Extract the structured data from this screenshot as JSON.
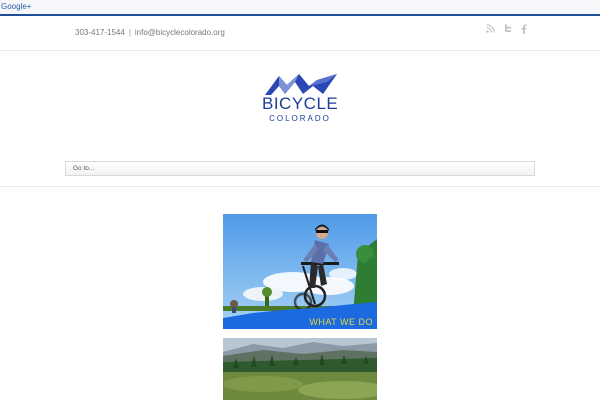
{
  "google_bar": {
    "link": "Google+"
  },
  "topbar": {
    "phone": "303-417-1544",
    "separator": "|",
    "email": "info@bicyclecolorado.org",
    "social_icons": [
      "rss-icon",
      "twitter-icon",
      "facebook-icon"
    ]
  },
  "logo": {
    "line1": "BICYCLE",
    "line2": "COLORADO",
    "color": "#1c3f9a"
  },
  "nav": {
    "select_label": "Go to..."
  },
  "tiles": [
    {
      "caption": "WHAT WE DO",
      "band_color": "#1f6fe0"
    },
    {
      "caption": ""
    }
  ],
  "colors": {
    "brand_blue": "#1c3f9a",
    "google_bar_border": "#1f4f96",
    "caption_yellow": "#e3d83a"
  }
}
